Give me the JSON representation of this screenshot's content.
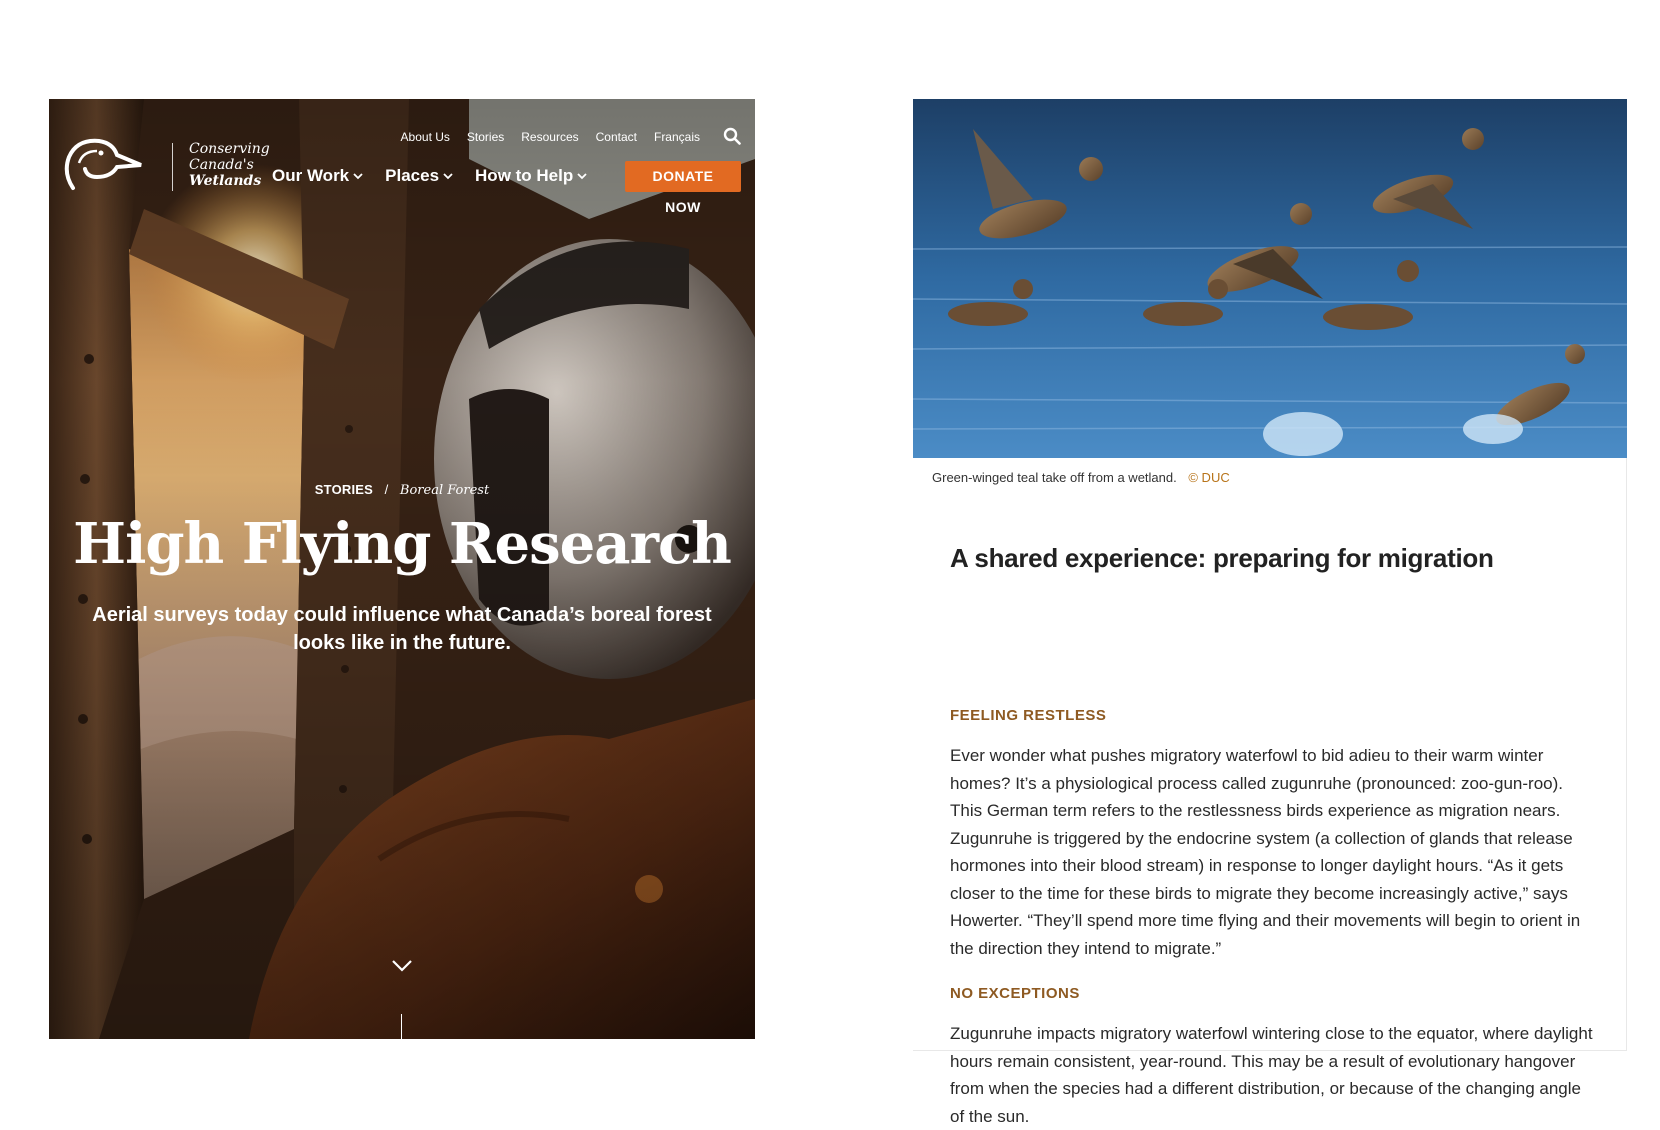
{
  "hero": {
    "logo": {
      "line1": "Conserving",
      "line2": "Canada's",
      "line3": "Wetlands"
    },
    "utility_nav": [
      "About Us",
      "Stories",
      "Resources",
      "Contact",
      "Français"
    ],
    "main_nav": [
      "Our Work",
      "Places",
      "How to Help"
    ],
    "donate_label": "DONATE NOW",
    "breadcrumb": {
      "section": "STORIES",
      "separator": "/",
      "topic": "Boreal Forest"
    },
    "title": "High Flying Research",
    "subtitle": "Aerial surveys today could influence what Canada’s boreal forest looks like in the future."
  },
  "article": {
    "caption": "Green-winged teal take off from a wetland.",
    "credit": "© DUC",
    "heading": "A shared experience: preparing for migration",
    "sections": [
      {
        "kicker": "FEELING RESTLESS",
        "body": "Ever wonder what pushes migratory waterfowl to bid adieu to their warm winter homes? It’s a physiological process called zugunruhe (pronounced: zoo-gun-roo). This German term refers to the restlessness birds experience as migration nears. Zugunruhe is triggered by the endocrine system (a collection of glands that release hormones into their blood stream) in response to longer daylight hours. “As it gets closer to the time for these birds to migrate they become increasingly active,” says Howerter. “They’ll spend more time flying and their movements will begin to orient in the direction they intend to migrate.”"
      },
      {
        "kicker": "NO EXCEPTIONS",
        "body": "Zugunruhe impacts migratory waterfowl wintering close to the equator, where daylight hours remain consistent, year-round. This may be a result of evolutionary hangover from when the species had a different distribution, or because of the changing angle of the sun."
      }
    ]
  },
  "colors": {
    "donate": "#e26a22",
    "kicker": "#8e5a22",
    "credit": "#b8741a"
  },
  "icons": [
    "duck-logo-icon",
    "search-icon",
    "chevron-down-icon",
    "scroll-down-icon"
  ]
}
